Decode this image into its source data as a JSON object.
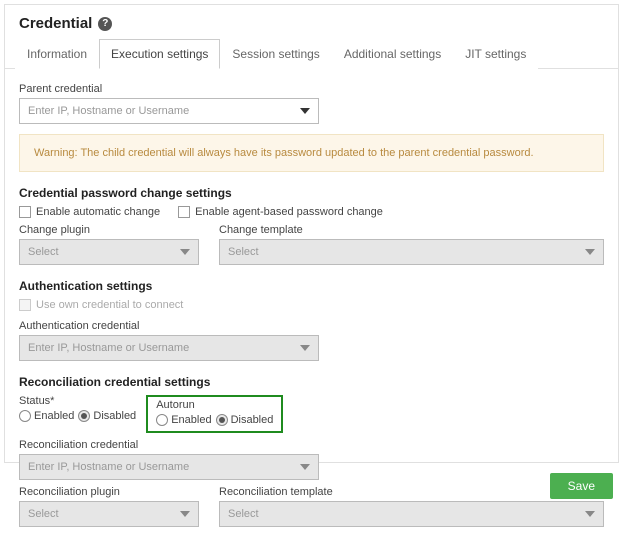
{
  "header": {
    "title": "Credential"
  },
  "tabs": [
    {
      "label": "Information"
    },
    {
      "label": "Execution settings"
    },
    {
      "label": "Session settings"
    },
    {
      "label": "Additional settings"
    },
    {
      "label": "JIT settings"
    }
  ],
  "parent": {
    "label": "Parent credential",
    "placeholder": "Enter IP, Hostname or Username"
  },
  "warning": {
    "text": "Warning: The child credential will always have its password updated to the parent credential password."
  },
  "password_section": {
    "title": "Credential password change settings",
    "enable_auto": "Enable automatic change",
    "enable_agent": "Enable agent-based password change",
    "plugin_label": "Change plugin",
    "plugin_placeholder": "Select",
    "template_label": "Change template",
    "template_placeholder": "Select"
  },
  "auth_section": {
    "title": "Authentication settings",
    "use_own": "Use own credential to connect",
    "cred_label": "Authentication credential",
    "cred_placeholder": "Enter IP, Hostname or Username"
  },
  "recon_section": {
    "title": "Reconciliation credential settings",
    "status_label": "Status*",
    "autorun_label": "Autorun",
    "enabled": "Enabled",
    "disabled": "Disabled",
    "cred_label": "Reconciliation credential",
    "cred_placeholder": "Enter IP, Hostname or Username",
    "plugin_label": "Reconciliation plugin",
    "plugin_placeholder": "Select",
    "template_label": "Reconciliation template",
    "template_placeholder": "Select"
  },
  "footer": {
    "save": "Save"
  }
}
